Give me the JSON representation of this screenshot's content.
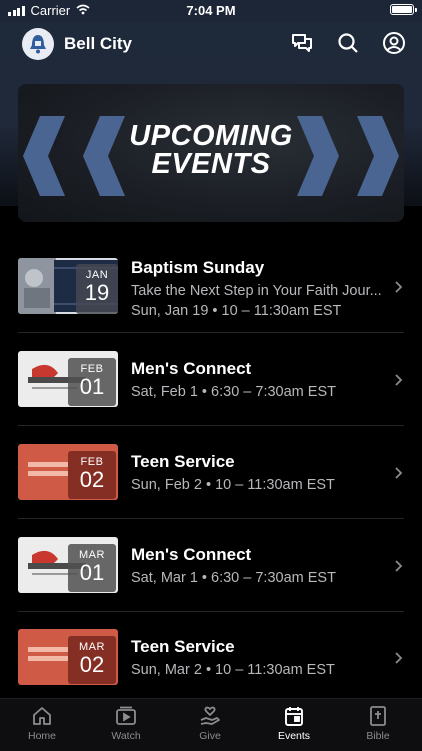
{
  "status": {
    "carrier": "Carrier",
    "time": "7:04 PM"
  },
  "header": {
    "app_name": "Bell City"
  },
  "banner": {
    "line1": "UPCOMING",
    "line2": "EVENTS"
  },
  "events": [
    {
      "month": "JAN",
      "day": "19",
      "title": "Baptism Sunday",
      "description": "Take the Next Step in Your Faith Jour...",
      "datetime": "Sun, Jan 19 • 10 – 11:30am EST"
    },
    {
      "month": "FEB",
      "day": "01",
      "title": "Men's Connect",
      "datetime": "Sat, Feb 1 • 6:30 – 7:30am EST"
    },
    {
      "month": "FEB",
      "day": "02",
      "title": "Teen Service",
      "datetime": "Sun, Feb 2 • 10 – 11:30am EST"
    },
    {
      "month": "MAR",
      "day": "01",
      "title": "Men's Connect",
      "datetime": "Sat, Mar 1 • 6:30 – 7:30am EST"
    },
    {
      "month": "MAR",
      "day": "02",
      "title": "Teen Service",
      "datetime": "Sun, Mar 2 • 10 – 11:30am EST"
    }
  ],
  "tabs": [
    {
      "label": "Home",
      "icon": "home-icon"
    },
    {
      "label": "Watch",
      "icon": "watch-icon"
    },
    {
      "label": "Give",
      "icon": "give-icon"
    },
    {
      "label": "Events",
      "icon": "calendar-icon",
      "active": true
    },
    {
      "label": "Bible",
      "icon": "bible-icon"
    }
  ],
  "colors": {
    "header_bg": "#1e2939",
    "accent_chevron": "#4a6591",
    "teen_red": "#cf5a45"
  }
}
